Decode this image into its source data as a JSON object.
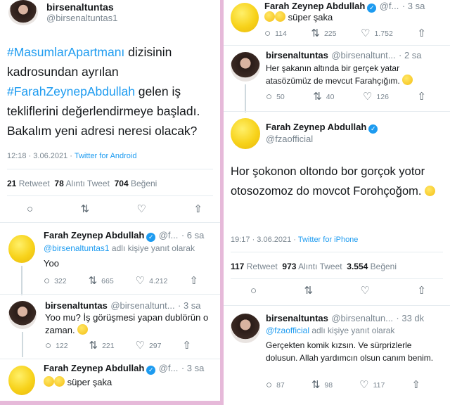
{
  "left": {
    "main": {
      "name": "birsenaltuntas",
      "handle": "@birsenaltuntas1",
      "hashtag1": "#MasumlarApartmanı",
      "text1": " dizisinin kadrosundan ayrılan",
      "hashtag2": "#FarahZeynepAbdullah",
      "text2": " gelen iş tekliflerini değerlendirmeye başladı. Bakalım yeni adresi neresi olacak?",
      "time": "12:18 · 3.06.2021 · ",
      "source": "Twitter for Android",
      "retweets": "21",
      "retweets_label": "Retweet",
      "quotes": "78",
      "quotes_label": "Alıntı Tweet",
      "likes": "704",
      "likes_label": "Beğeni"
    },
    "replies": [
      {
        "name": "Farah Zeynep Abdullah",
        "handle": "@f...",
        "time": "· 6 sa",
        "reply_to_handle": "@birsenaltuntas1",
        "reply_to_suffix": " adlı kişiye yanıt olarak",
        "text": "Yoo",
        "stats": [
          "322",
          "665",
          "4.212"
        ]
      },
      {
        "name": "birsenaltuntas",
        "handle": "@birsenaltunt...",
        "time": "· 3 sa",
        "text": "Yoo mu? İş görüşmesi yapan dublörün o zaman.",
        "stats": [
          "122",
          "221",
          "297"
        ]
      },
      {
        "name": "Farah Zeynep Abdullah",
        "handle": "@f...",
        "time": "· 3 sa",
        "text": "süper şaka"
      }
    ]
  },
  "right": {
    "top": {
      "name": "Farah Zeynep Abdullah",
      "handle": "@f...",
      "time": "· 3 sa",
      "text": "süper şaka",
      "stats": [
        "114",
        "225",
        "1.752"
      ]
    },
    "reply": {
      "name": "birsenaltuntas",
      "handle": "@birsenaltunt...",
      "time": "· 2 sa",
      "text": "Her şakanın altında bir gerçek yatar atasözümüz de mevcut Farahçığım.",
      "stats": [
        "50",
        "40",
        "126"
      ]
    },
    "main": {
      "name": "Farah Zeynep Abdullah",
      "handle": "@fzaofficial",
      "text": "Hor şokonon oltondo bor gorçok yotor otosozomoz do movcot Forohçoğom.",
      "time": "19:17 · 3.06.2021 · ",
      "source": "Twitter for iPhone",
      "retweets": "117",
      "retweets_label": "Retweet",
      "quotes": "973",
      "quotes_label": "Alıntı Tweet",
      "likes": "3.554",
      "likes_label": "Beğeni"
    },
    "bottom": {
      "name": "birsenaltuntas",
      "handle": "@birsenaltun...",
      "time": "· 33 dk",
      "reply_to_handle": "@fzaofficial",
      "reply_to_suffix": " adlı kişiye yanıt olarak",
      "text": "Gerçekten komik kızsın. Ve sürprizlerle dolusun. Allah yardımcın olsun canım benim.",
      "stats": [
        "87",
        "98",
        "117"
      ]
    }
  },
  "icons": {
    "reply": "reply-icon",
    "retweet": "retweet-icon",
    "like": "like-icon",
    "share": "share-icon",
    "verified": "verified-badge-icon"
  }
}
